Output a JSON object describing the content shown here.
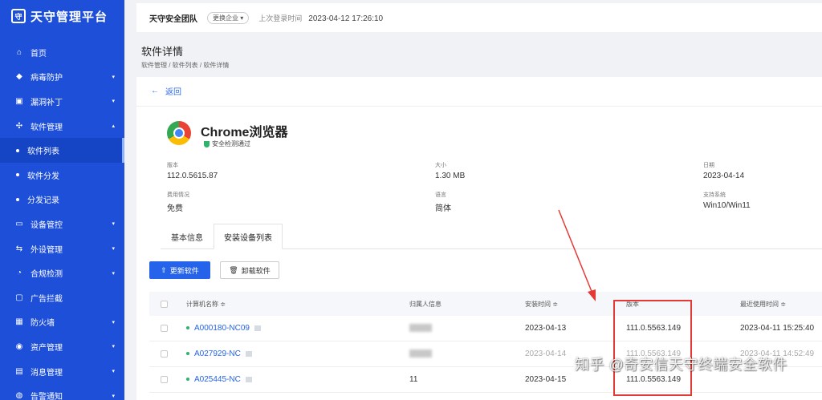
{
  "app": {
    "logo_mark": "守",
    "title": "天守管理平台"
  },
  "sidebar": {
    "items": [
      {
        "label": "首页",
        "icon": "home-icon",
        "glyph": "⌂"
      },
      {
        "label": "病毒防护",
        "icon": "shield-icon",
        "glyph": "◆",
        "caret": "▾"
      },
      {
        "label": "漏洞补丁",
        "icon": "toolbox-icon",
        "glyph": "▣",
        "caret": "▾"
      },
      {
        "label": "软件管理",
        "icon": "grid-icon",
        "glyph": "✣",
        "caret": "▴"
      },
      {
        "label": "软件列表",
        "sub": true,
        "active": true
      },
      {
        "label": "软件分发",
        "sub": true
      },
      {
        "label": "分发记录",
        "sub": true
      },
      {
        "label": "设备管控",
        "icon": "monitor-icon",
        "glyph": "▭",
        "caret": "▾"
      },
      {
        "label": "外设管理",
        "icon": "usb-icon",
        "glyph": "⇆",
        "caret": "▾"
      },
      {
        "label": "合规检测",
        "icon": "clock-icon",
        "glyph": "◔",
        "caret": "▾"
      },
      {
        "label": "广告拦截",
        "icon": "block-icon",
        "glyph": "▢"
      },
      {
        "label": "防火墙",
        "icon": "firewall-icon",
        "glyph": "▦",
        "caret": "▾"
      },
      {
        "label": "资产管理",
        "icon": "database-icon",
        "glyph": "◉",
        "caret": "▾"
      },
      {
        "label": "消息管理",
        "icon": "message-icon",
        "glyph": "▤",
        "caret": "▾"
      },
      {
        "label": "告警通知",
        "icon": "bell-icon",
        "glyph": "◍",
        "caret": "▾"
      }
    ]
  },
  "topbar": {
    "team": "天守安全团队",
    "switch_label": "更换企业 ▾",
    "last_login_label": "上次登录时间",
    "last_login_value": "2023-04-12 17:26:10"
  },
  "page": {
    "title": "软件详情",
    "breadcrumb": "软件管理 / 软件列表 / 软件详情",
    "back_label": "返回"
  },
  "software": {
    "name": "Chrome浏览器",
    "safety": "安全检测通过",
    "fields": {
      "version_label": "版本",
      "version_value": "112.0.5615.87",
      "size_label": "大小",
      "size_value": "1.30 MB",
      "date_label": "日期",
      "date_value": "2023-04-14",
      "license_label": "费用情况",
      "license_value": "免费",
      "language_label": "语言",
      "language_value": "简体",
      "os_label": "支持系统",
      "os_value": "Win10/Win11"
    }
  },
  "tabs": {
    "basic": "基本信息",
    "devices": "安装设备列表"
  },
  "actions": {
    "update": "更新软件",
    "uninstall": "卸载软件"
  },
  "table": {
    "headers": {
      "computer": "计算机名称 ≑",
      "owner": "归属人信息",
      "install_time": "安装时间 ≑",
      "version": "版本",
      "last_used": "最近使用时间 ≑"
    },
    "rows": [
      {
        "computer": "A000180-NC09",
        "owner": "",
        "install_time": "2023-04-13",
        "version": "111.0.5563.149",
        "last_used": "2023-04-11 15:25:40"
      },
      {
        "computer": "A027929-NC",
        "owner": "",
        "install_time": "2023-04-14",
        "version": "111.0.5563.149",
        "last_used": "2023-04-11 14:52:49"
      },
      {
        "computer": "A025445-NC",
        "owner": "11",
        "install_time": "2023-04-15",
        "version": "111.0.5563.149",
        "last_used": ""
      }
    ]
  },
  "watermark": "知乎 @奇安信天守终端安全软件",
  "colors": {
    "sidebar": "#1d4fd8",
    "primary": "#2563eb",
    "annotation": "#e53935",
    "safe": "#2fb36b"
  }
}
